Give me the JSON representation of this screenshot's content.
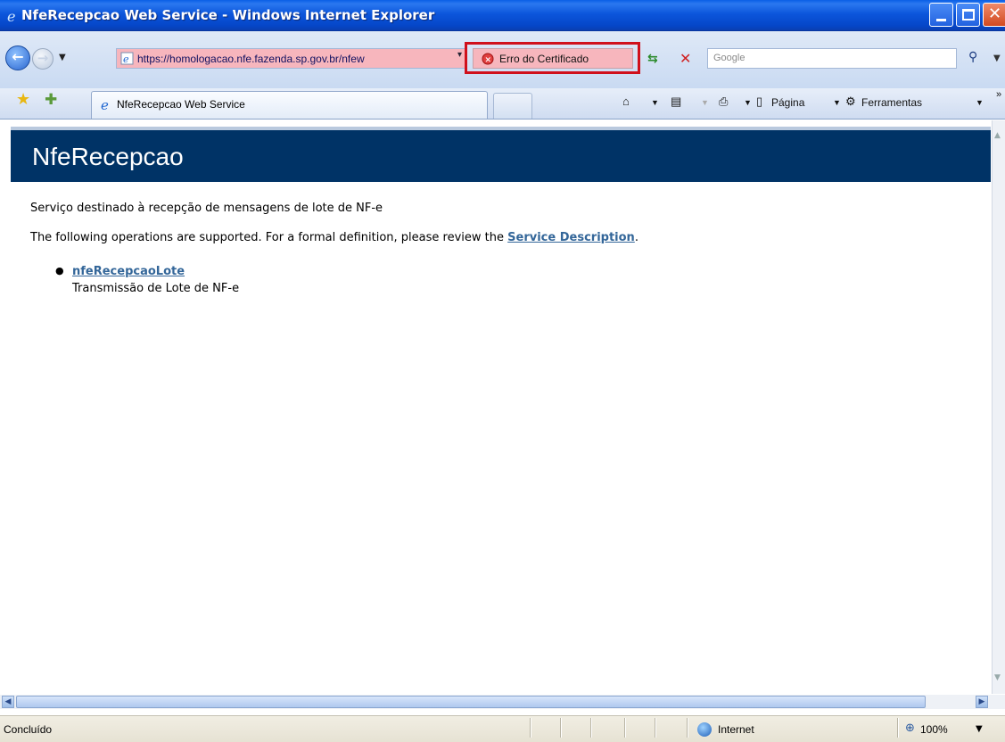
{
  "window": {
    "title": "NfeRecepcao Web Service - Windows Internet Explorer"
  },
  "nav": {
    "address": "https://homologacao.nfe.fazenda.sp.gov.br/nfew",
    "certificate_error": "Erro do Certificado",
    "search_placeholder": "Google"
  },
  "tabs": [
    {
      "label": "NfeRecepcao Web Service"
    }
  ],
  "toolbar": {
    "page_label": "Página",
    "tools_label": "Ferramentas"
  },
  "page": {
    "heading": "NfeRecepcao",
    "description": "Serviço destinado à recepção de mensagens de lote de NF-e",
    "ops_intro": "The following operations are supported. For a formal definition, please review the",
    "service_description_link": "Service Description",
    "ops_intro_end": ".",
    "operations": [
      {
        "name": "nfeRecepcaoLote",
        "description": "Transmissão de Lote de NF-e"
      }
    ]
  },
  "status": {
    "text": "Concluído",
    "zone": "Internet",
    "zoom": "100%"
  },
  "colors": {
    "heading_bg": "#003366",
    "link": "#336699",
    "cert_error_highlight": "#d0101c"
  }
}
